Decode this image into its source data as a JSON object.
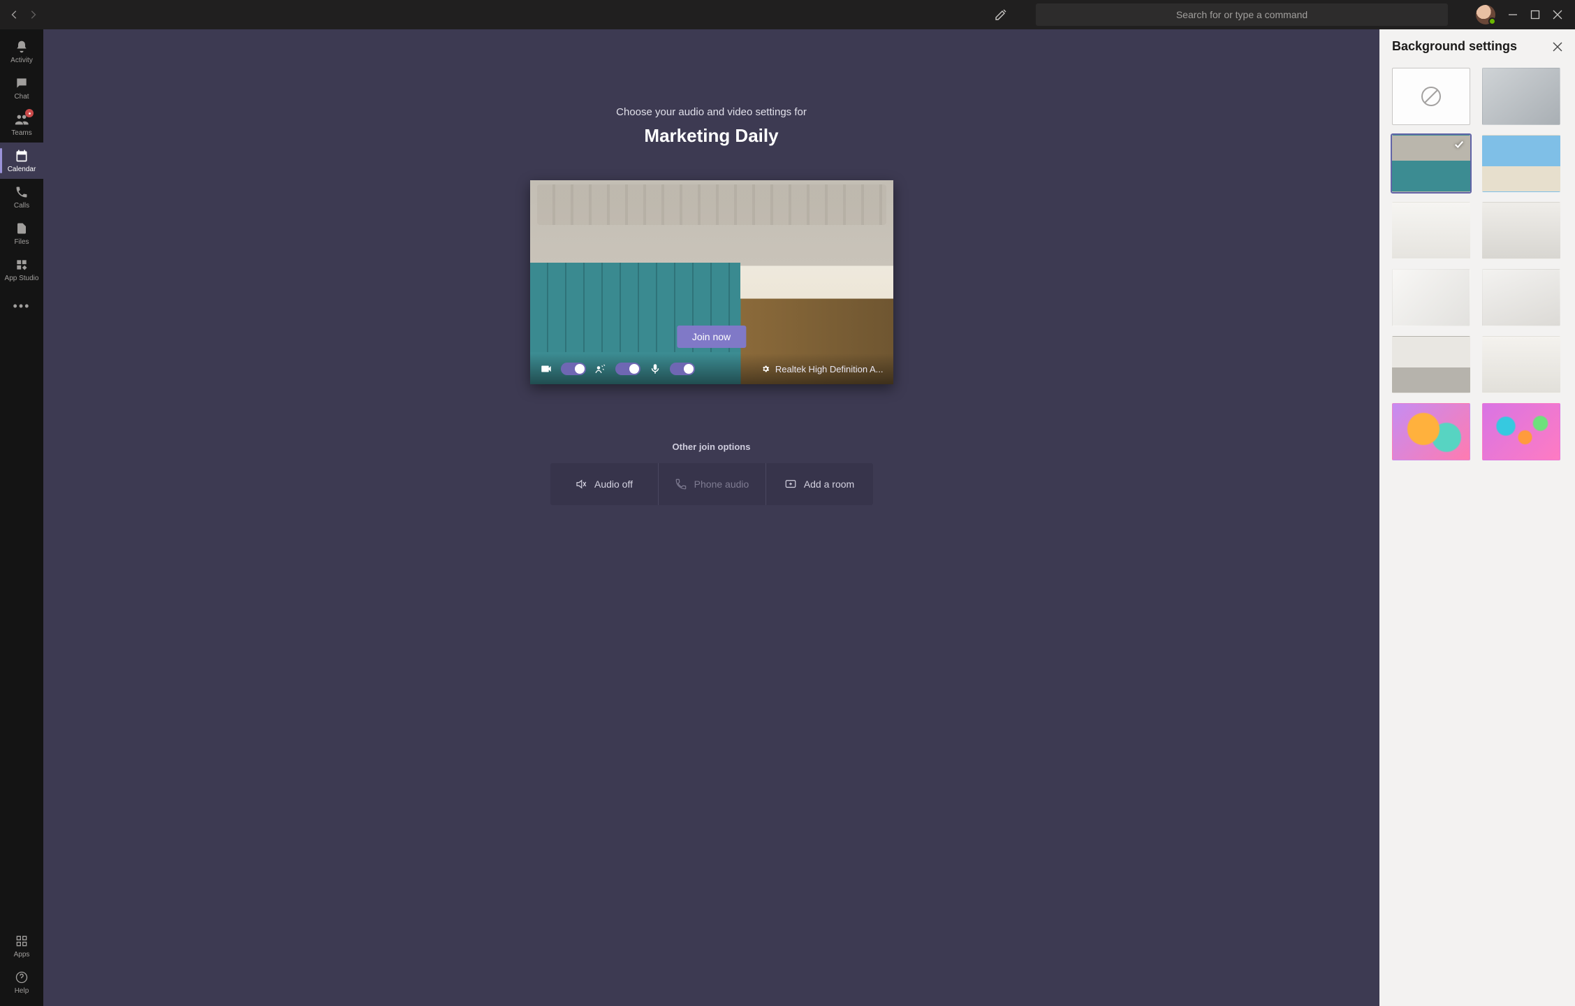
{
  "titlebar": {
    "search_placeholder": "Search for or type a command"
  },
  "rail": {
    "items": [
      {
        "label": "Activity"
      },
      {
        "label": "Chat"
      },
      {
        "label": "Teams"
      },
      {
        "label": "Calendar"
      },
      {
        "label": "Calls"
      },
      {
        "label": "Files"
      },
      {
        "label": "App Studio"
      }
    ],
    "apps_label": "Apps",
    "help_label": "Help"
  },
  "stage": {
    "prompt": "Choose your audio and video settings for",
    "meeting_title": "Marketing Daily",
    "join_label": "Join now",
    "device_label": "Realtek High Definition A...",
    "other_header": "Other join options",
    "options": {
      "audio_off": "Audio off",
      "phone_audio": "Phone audio",
      "add_room": "Add a room"
    }
  },
  "bgpanel": {
    "title": "Background settings"
  }
}
